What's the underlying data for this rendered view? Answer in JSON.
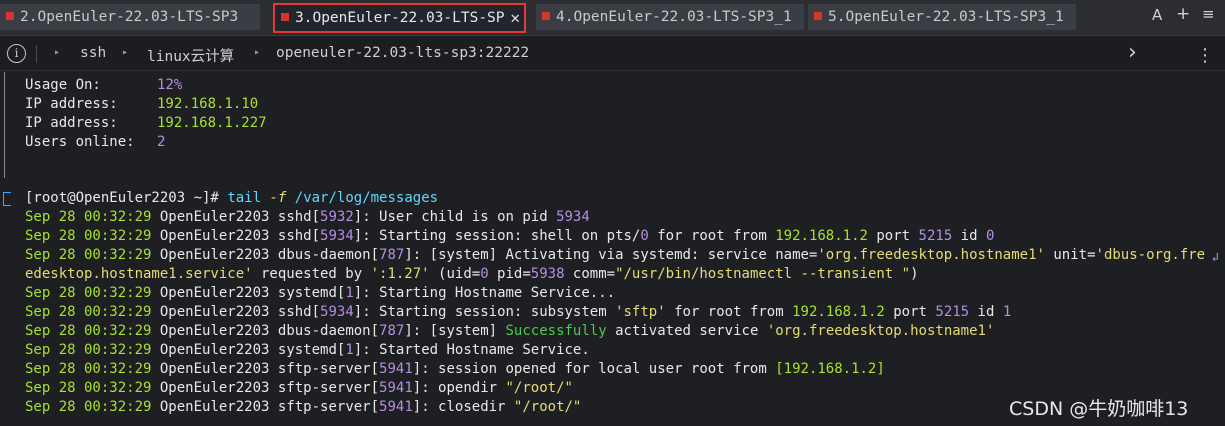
{
  "tabs": [
    {
      "label": "2.OpenEuler-22.03-LTS-SP3",
      "active": false
    },
    {
      "label": "3.OpenEuler-22.03-LTS-SP",
      "active": true
    },
    {
      "label": "4.OpenEuler-22.03-LTS-SP3_1",
      "active": false
    },
    {
      "label": "5.OpenEuler-22.03-LTS-SP3_1",
      "active": false
    }
  ],
  "tab_controls": {
    "font": "A",
    "add": "+",
    "menu": "≡"
  },
  "breadcrumb": {
    "items": [
      "ssh",
      "linux云计算",
      "openeuler-22.03-lts-sp3:22222"
    ]
  },
  "sysinfo": {
    "usage_label": "Usage On:",
    "usage_value": "12%",
    "ip1_label": "IP address:",
    "ip1_value": "192.168.1.10",
    "ip2_label": "IP address:",
    "ip2_value": "192.168.1.227",
    "users_label": "Users online:",
    "users_value": "2"
  },
  "prompt": {
    "text": "[root@OpenEuler2203 ~]#",
    "command": "tail",
    "flag": "-f",
    "path": "/var/log/messages"
  },
  "log": {
    "l1": {
      "ts": "Sep 28 00:32:29",
      "host": "OpenEuler2203",
      "proc": "sshd",
      "pid": "5932",
      "msg_a": ": User child is on pid ",
      "msg_b": "5934"
    },
    "l2": {
      "ts": "Sep 28 00:32:29",
      "host": "OpenEuler2203",
      "proc": "sshd",
      "pid": "5934",
      "msg_a": ": Starting session: shell on pts/",
      "n1": "0",
      "msg_b": " for root from ",
      "ip": "192.168.1.2",
      "msg_c": " port ",
      "port": "5215",
      "msg_d": " id ",
      "id": "0"
    },
    "l3": {
      "ts": "Sep 28 00:32:29",
      "host": "OpenEuler2203",
      "proc": "dbus-daemon",
      "pid": "787",
      "msg_a": ": [system] Activating via systemd: service name=",
      "name": "'org.freedesktop.hostname1'",
      "msg_b": " unit=",
      "unit": "'dbus-org.fre"
    },
    "l3b": {
      "unit2": "edesktop.hostname1.service'",
      "msg_a": " requested by ",
      "by": "':1.27'",
      "msg_b": " (uid=",
      "uid": "0",
      "msg_c": " pid=",
      "pid2": "5938",
      "msg_d": " comm=",
      "comm": "\"/usr/bin/hostnamectl --transient \"",
      "msg_e": ")"
    },
    "l4": {
      "ts": "Sep 28 00:32:29",
      "host": "OpenEuler2203",
      "proc": "systemd",
      "pid": "1",
      "msg": ": Starting Hostname Service..."
    },
    "l5": {
      "ts": "Sep 28 00:32:29",
      "host": "OpenEuler2203",
      "proc": "sshd",
      "pid": "5934",
      "msg_a": ": Starting session: subsystem ",
      "sub": "'sftp'",
      "msg_b": " for root from ",
      "ip": "192.168.1.2",
      "msg_c": " port ",
      "port": "5215",
      "msg_d": " id ",
      "id": "1"
    },
    "l6": {
      "ts": "Sep 28 00:32:29",
      "host": "OpenEuler2203",
      "proc": "dbus-daemon",
      "pid": "787",
      "msg_a": ": [system] ",
      "ok": "Successfully",
      "msg_b": " activated service ",
      "svc": "'org.freedesktop.hostname1'"
    },
    "l7": {
      "ts": "Sep 28 00:32:29",
      "host": "OpenEuler2203",
      "proc": "systemd",
      "pid": "1",
      "msg": ": Started Hostname Service."
    },
    "l8": {
      "ts": "Sep 28 00:32:29",
      "host": "OpenEuler2203",
      "proc": "sftp-server",
      "pid": "5941",
      "msg_a": ": session opened for local user root from ",
      "ip": "[192.168.1.2]"
    },
    "l9": {
      "ts": "Sep 28 00:32:29",
      "host": "OpenEuler2203",
      "proc": "sftp-server",
      "pid": "5941",
      "msg_a": ": opendir ",
      "dir": "\"/root/\""
    },
    "l10": {
      "ts": "Sep 28 00:32:29",
      "host": "OpenEuler2203",
      "proc": "sftp-server",
      "pid": "5941",
      "msg_a": ": closedir ",
      "dir": "\"/root/\""
    }
  },
  "wrap_marker": "↲",
  "watermark": "CSDN @牛奶咖啡13"
}
